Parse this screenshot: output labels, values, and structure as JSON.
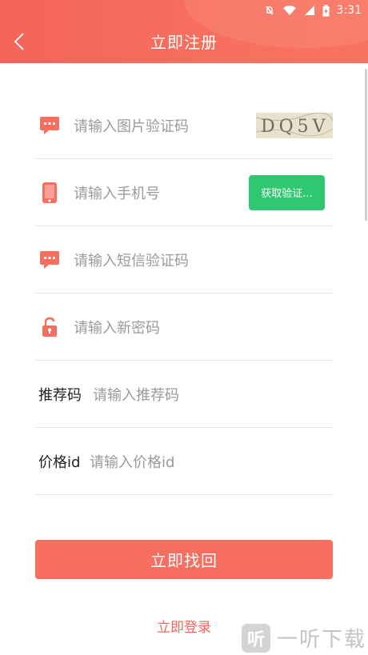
{
  "status_bar": {
    "time": "3:31"
  },
  "header": {
    "title": "立即注册"
  },
  "form": {
    "captcha": {
      "placeholder": "请输入图片验证码",
      "captcha_text": "DQ5V"
    },
    "phone": {
      "placeholder": "请输入手机号",
      "send_code_label": "获取验证..."
    },
    "sms": {
      "placeholder": "请输入短信验证码"
    },
    "password": {
      "placeholder": "请输入新密码"
    },
    "referral": {
      "label": "推荐码",
      "placeholder": "请输入推荐码"
    },
    "price": {
      "label": "价格id",
      "placeholder": "请输入价格id"
    }
  },
  "actions": {
    "submit_label": "立即找回",
    "login_link": "立即登录"
  },
  "watermark": {
    "logo_char": "听",
    "text": "一听下载"
  },
  "colors": {
    "brand": "#f4645a",
    "button": "#f56e60",
    "green": "#2fc870"
  }
}
